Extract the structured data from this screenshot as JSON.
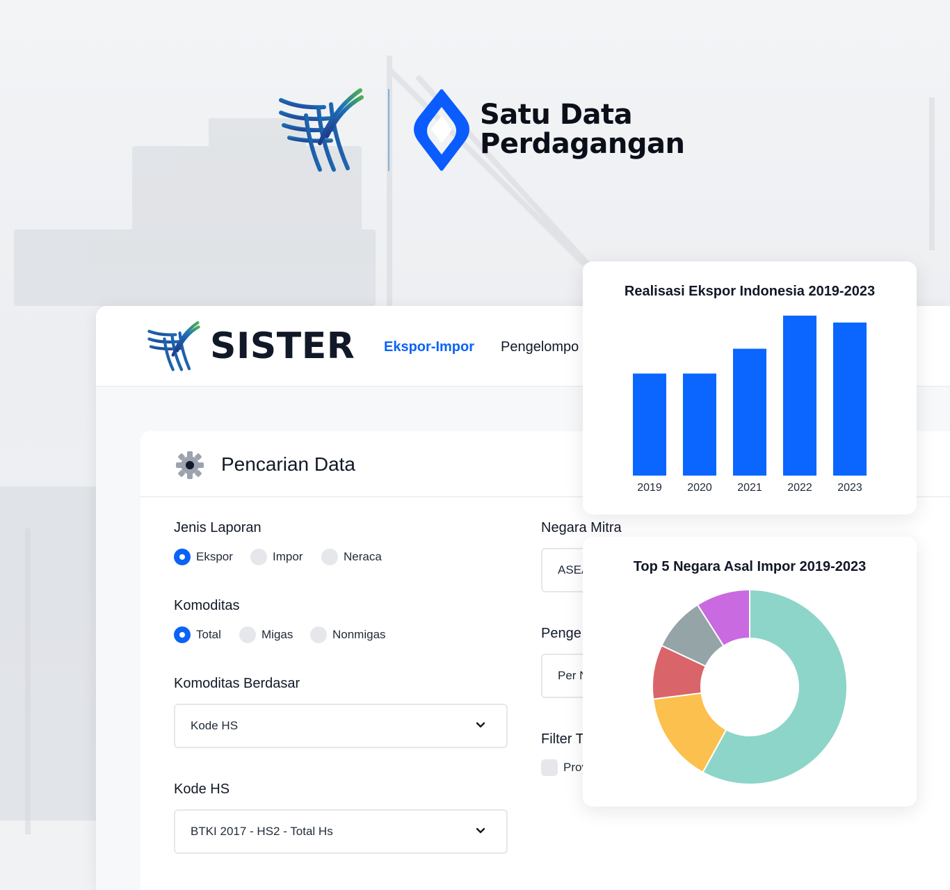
{
  "hero": {
    "brand_line1": "Satu Data",
    "brand_line2": "Perdagangan"
  },
  "app": {
    "name": "SISTER",
    "nav": [
      {
        "label": "Ekspor-Impor",
        "active": true
      },
      {
        "label": "Pengelompo",
        "active": false
      }
    ]
  },
  "search_card": {
    "title": "Pencarian Data",
    "jenis_laporan": {
      "label": "Jenis Laporan",
      "options": [
        "Ekspor",
        "Impor",
        "Neraca"
      ],
      "selected": "Ekspor"
    },
    "komoditas": {
      "label": "Komoditas",
      "options": [
        "Total",
        "Migas",
        "Nonmigas"
      ],
      "selected": "Total"
    },
    "komoditas_berdasar": {
      "label": "Komoditas Berdasar",
      "value": "Kode HS"
    },
    "kode_hs": {
      "label": "Kode HS",
      "value": "BTKI 2017 - HS2 - Total Hs"
    },
    "negara_mitra": {
      "label": "Negara Mitra",
      "value": "ASEA"
    },
    "pengelompokan": {
      "label": "Penge",
      "value": "Per N"
    },
    "filter": {
      "label": "Filter T",
      "checkbox_label": "Prov"
    }
  },
  "colors": {
    "accent": "#0b63f6",
    "bar": "#0a66ff"
  },
  "chart_data": [
    {
      "type": "bar",
      "title": "Realisasi Ekspor Indonesia 2019-2023",
      "categories": [
        "2019",
        "2020",
        "2021",
        "2022",
        "2023"
      ],
      "values": [
        148,
        148,
        184,
        232,
        222
      ],
      "ylim": [
        0,
        240
      ],
      "grid": false,
      "color": "#0a66ff"
    },
    {
      "type": "pie",
      "title": "Top 5 Negara Asal Impor 2019-2023",
      "donut": true,
      "values": [
        58,
        15,
        9,
        9,
        9
      ],
      "colors": [
        "#8dd5c8",
        "#fbc04d",
        "#d9646a",
        "#95a4a6",
        "#c96ae0"
      ]
    }
  ]
}
